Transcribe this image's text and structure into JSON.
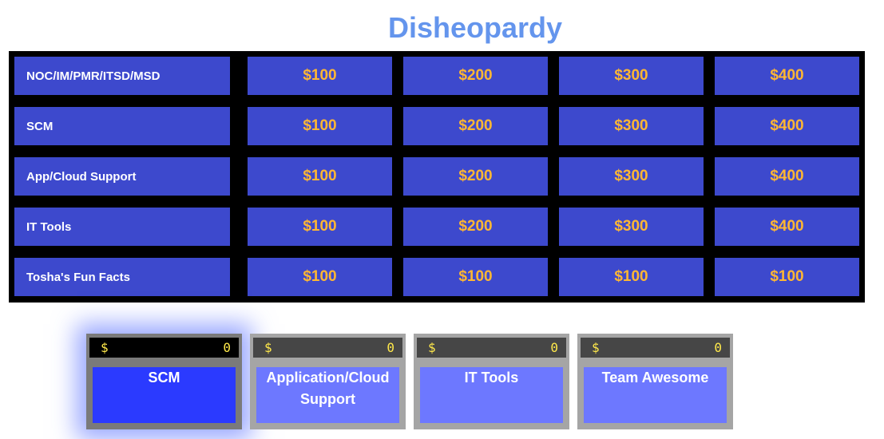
{
  "title": "Disheopardy",
  "board": {
    "rows": [
      {
        "category": "NOC/IM/PMR/ITSD/MSD",
        "values": [
          "$100",
          "$200",
          "$300",
          "$400"
        ]
      },
      {
        "category": "SCM",
        "values": [
          "$100",
          "$200",
          "$300",
          "$400"
        ]
      },
      {
        "category": "App/Cloud Support",
        "values": [
          "$100",
          "$200",
          "$300",
          "$400"
        ]
      },
      {
        "category": "IT Tools",
        "values": [
          "$100",
          "$200",
          "$300",
          "$400"
        ]
      },
      {
        "category": "Tosha's Fun Facts",
        "values": [
          "$100",
          "$100",
          "$100",
          "$100"
        ]
      }
    ]
  },
  "teams": [
    {
      "currency": "$",
      "score": "0",
      "name": "SCM",
      "active": true
    },
    {
      "currency": "$",
      "score": "0",
      "name": "Application/Cloud Support",
      "active": false
    },
    {
      "currency": "$",
      "score": "0",
      "name": "IT Tools",
      "active": false
    },
    {
      "currency": "$",
      "score": "0",
      "name": "Team Awesome",
      "active": false
    }
  ],
  "colors": {
    "title": "#6495ED",
    "board_background": "#000000",
    "cell": "#3D49CD",
    "value_text": "#FFB733",
    "score_text": "#FFE94A",
    "team_active": "#2B3AFF",
    "team_inactive": "#6D78FF"
  }
}
